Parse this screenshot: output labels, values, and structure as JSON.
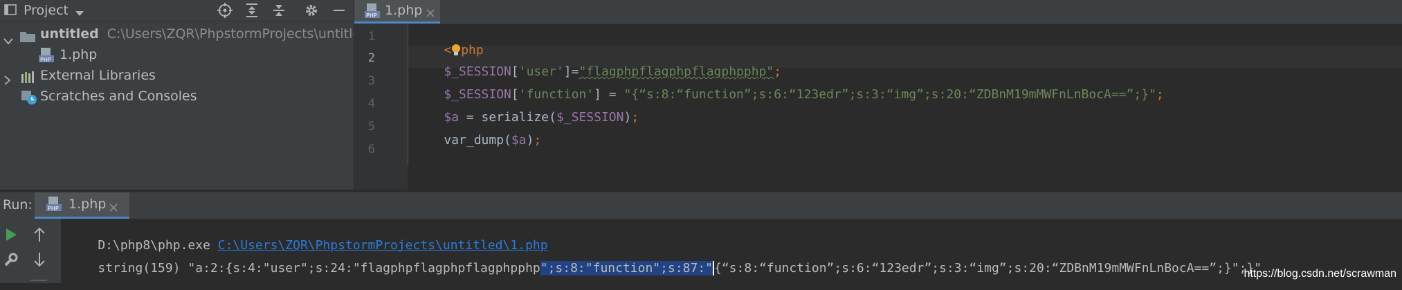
{
  "project_panel": {
    "title": "Project",
    "tree": {
      "root_name": "untitled",
      "root_path": "C:\\Users\\ZQR\\PhpstormProjects\\untitled",
      "file": "1.php",
      "external_libraries": "External Libraries",
      "scratches": "Scratches and Consoles"
    }
  },
  "editor": {
    "tab_label": "1.php",
    "lines": [
      {
        "no": "1"
      },
      {
        "no": "2"
      },
      {
        "no": "3"
      },
      {
        "no": "4"
      },
      {
        "no": "5"
      },
      {
        "no": "6"
      }
    ],
    "code": {
      "l1_open": "<",
      "l1_php": "php",
      "l2_var": "$_SESSION",
      "l2_b1": "[",
      "l2_key": "'user'",
      "l2_b2": "]=",
      "l2_val": "\"flagphpflagphpflagphpphp\"",
      "l2_semi": ";",
      "l3_var": "$_SESSION",
      "l3_b1": "[",
      "l3_key": "'function'",
      "l3_b2": "] = ",
      "l3_val": "\"{“s:8:“function”;s:6:“123edr”;s:3:“img”;s:20:“ZDBnM19mMWFnLnBocA==”;}\"",
      "l3_semi": ";",
      "l4_var": "$a",
      "l4_mid": " = serialize(",
      "l4_arg": "$_SESSION",
      "l4_close": ")",
      "l4_semi": ";",
      "l5_fn": "var_dump(",
      "l5_arg": "$a",
      "l5_close": ")",
      "l5_semi": ";"
    }
  },
  "run": {
    "label": "Run:",
    "tab_label": "1.php",
    "console": {
      "line1_prefix": "D:\\php8\\php.exe ",
      "line1_link": "C:\\Users\\ZQR\\PhpstormProjects\\untitled\\1.php",
      "line2_a": "string(159) \"a:2:{s:4:\"user\";s:24:\"flagphpflagphpflagphpphp",
      "line2_sel": "\";s:8:\"function\";s:87:\"",
      "line2_caret": "{",
      "line2_b": "“s:8:“function”;s:6:“123edr”;s:3:“img”;s:20:“ZDBnM19mMWFnLnBocA==”;}\";}\""
    }
  },
  "watermark": "https://blog.csdn.net/scrawman",
  "colors": {
    "accent": "#4a88c7",
    "selection": "#214283",
    "link": "#287bde",
    "string": "#6a8759",
    "variable": "#9876aa",
    "keyword": "#cc7832"
  }
}
